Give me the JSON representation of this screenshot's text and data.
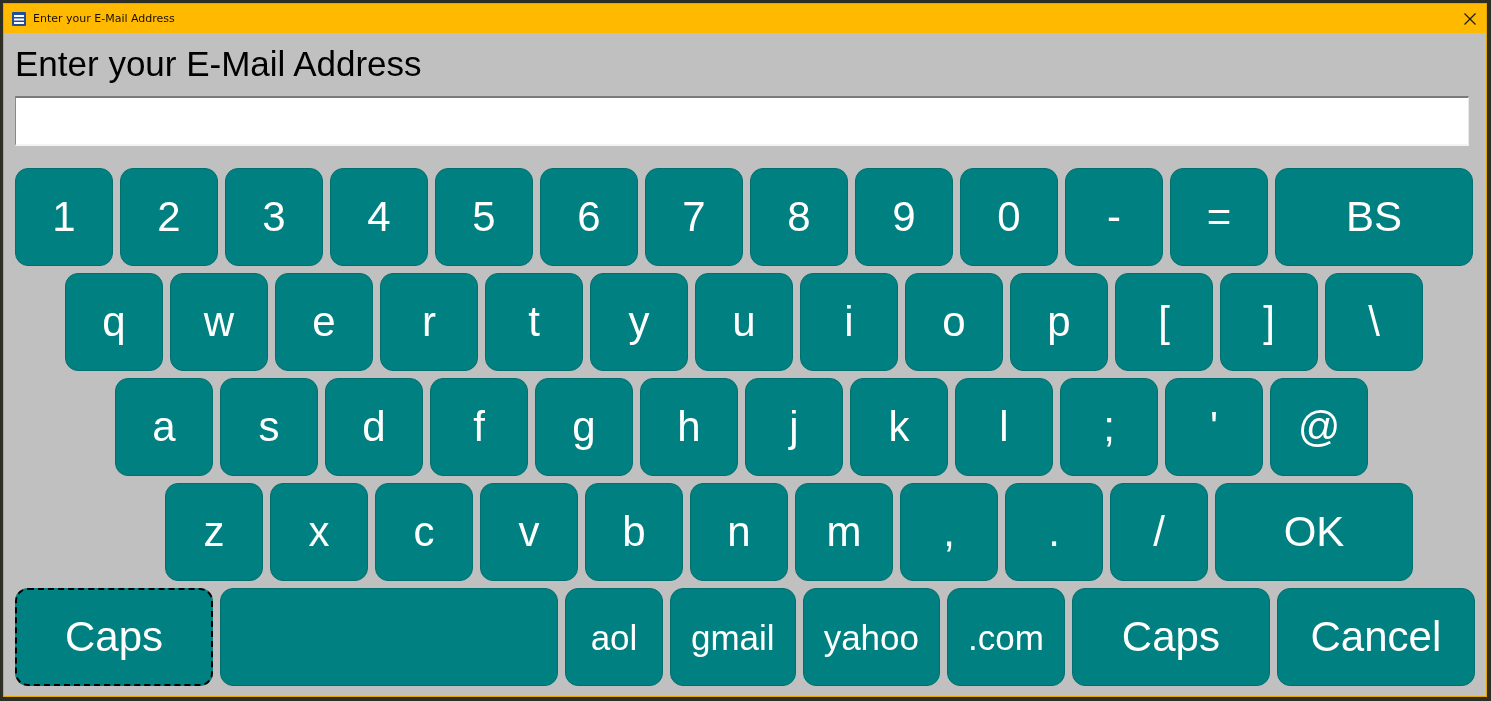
{
  "window": {
    "title": "Enter your E-Mail Address"
  },
  "prompt": "Enter your E-Mail Address",
  "keyboard": {
    "rows": [
      {
        "keys": [
          {
            "label": "1",
            "kind": "char",
            "focused": false
          },
          {
            "label": "2",
            "kind": "char",
            "focused": false
          },
          {
            "label": "3",
            "kind": "char",
            "focused": false
          },
          {
            "label": "4",
            "kind": "char",
            "focused": false
          },
          {
            "label": "5",
            "kind": "char",
            "focused": false
          },
          {
            "label": "6",
            "kind": "char",
            "focused": false
          },
          {
            "label": "7",
            "kind": "char",
            "focused": false
          },
          {
            "label": "8",
            "kind": "char",
            "focused": false
          },
          {
            "label": "9",
            "kind": "char",
            "focused": false
          },
          {
            "label": "0",
            "kind": "char",
            "focused": false
          },
          {
            "label": "-",
            "kind": "char",
            "focused": false
          },
          {
            "label": "=",
            "kind": "char",
            "focused": false
          },
          {
            "label": "BS",
            "kind": "wide",
            "focused": false
          }
        ]
      },
      {
        "keys": [
          {
            "label": "q",
            "kind": "char",
            "focused": false
          },
          {
            "label": "w",
            "kind": "char",
            "focused": false
          },
          {
            "label": "e",
            "kind": "char",
            "focused": false
          },
          {
            "label": "r",
            "kind": "char",
            "focused": false
          },
          {
            "label": "t",
            "kind": "char",
            "focused": false
          },
          {
            "label": "y",
            "kind": "char",
            "focused": false
          },
          {
            "label": "u",
            "kind": "char",
            "focused": false
          },
          {
            "label": "i",
            "kind": "char",
            "focused": false
          },
          {
            "label": "o",
            "kind": "char",
            "focused": false
          },
          {
            "label": "p",
            "kind": "char",
            "focused": false
          },
          {
            "label": "[",
            "kind": "char",
            "focused": false
          },
          {
            "label": "]",
            "kind": "char",
            "focused": false
          },
          {
            "label": "\\",
            "kind": "char",
            "focused": false
          }
        ]
      },
      {
        "keys": [
          {
            "label": "a",
            "kind": "char",
            "focused": false
          },
          {
            "label": "s",
            "kind": "char",
            "focused": false
          },
          {
            "label": "d",
            "kind": "char",
            "focused": false
          },
          {
            "label": "f",
            "kind": "char",
            "focused": false
          },
          {
            "label": "g",
            "kind": "char",
            "focused": false
          },
          {
            "label": "h",
            "kind": "char",
            "focused": false
          },
          {
            "label": "j",
            "kind": "char",
            "focused": false
          },
          {
            "label": "k",
            "kind": "char",
            "focused": false
          },
          {
            "label": "l",
            "kind": "char",
            "focused": false
          },
          {
            "label": ";",
            "kind": "char",
            "focused": false
          },
          {
            "label": "'",
            "kind": "char",
            "focused": false
          },
          {
            "label": "@",
            "kind": "char",
            "focused": false
          }
        ]
      },
      {
        "keys": [
          {
            "label": "z",
            "kind": "char",
            "focused": false
          },
          {
            "label": "x",
            "kind": "char",
            "focused": false
          },
          {
            "label": "c",
            "kind": "char",
            "focused": false
          },
          {
            "label": "v",
            "kind": "char",
            "focused": false
          },
          {
            "label": "b",
            "kind": "char",
            "focused": false
          },
          {
            "label": "n",
            "kind": "char",
            "focused": false
          },
          {
            "label": "m",
            "kind": "char",
            "focused": false
          },
          {
            "label": ",",
            "kind": "char",
            "focused": false
          },
          {
            "label": ".",
            "kind": "char",
            "focused": false
          },
          {
            "label": "/",
            "kind": "char",
            "focused": false
          },
          {
            "label": "OK",
            "kind": "wide",
            "focused": false
          }
        ]
      },
      {
        "keys": [
          {
            "label": "Caps",
            "kind": "wide",
            "focused": true
          },
          {
            "kind": "space",
            "focused": false
          },
          {
            "label": "aol",
            "kind": "domain",
            "focused": false
          },
          {
            "label": "gmail",
            "kind": "domain",
            "focused": false
          },
          {
            "label": "yahoo",
            "kind": "domain",
            "focused": false
          },
          {
            "label": ".com",
            "kind": "domain",
            "focused": false
          },
          {
            "label": "Caps",
            "kind": "wide",
            "focused": false
          },
          {
            "label": "Cancel",
            "kind": "wide",
            "focused": false
          }
        ]
      }
    ]
  }
}
